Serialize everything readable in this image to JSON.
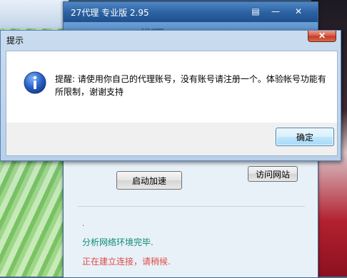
{
  "app": {
    "title": "27代理 专业版 2.95",
    "banner_text": "27代理",
    "start_button": "启动加速",
    "visit_button": "访问网站",
    "dot": ".",
    "status_lines": [
      "分析网络环境完毕.",
      "正在建立连接，请稍候."
    ]
  },
  "dialog": {
    "title": "提示",
    "close_glyph": "✕",
    "message": "提醒: 请使用你自己的代理账号，没有账号请注册一个。体验帐号功能有所限制，谢谢支持",
    "ok_button": "确定"
  },
  "colors": {
    "status_ok": "#0a8a76",
    "status_wait": "#e04a4a",
    "info_icon": "#2a62c9"
  },
  "icons": [
    "info-icon",
    "close-icon",
    "minimize-icon",
    "menu-icon"
  ]
}
